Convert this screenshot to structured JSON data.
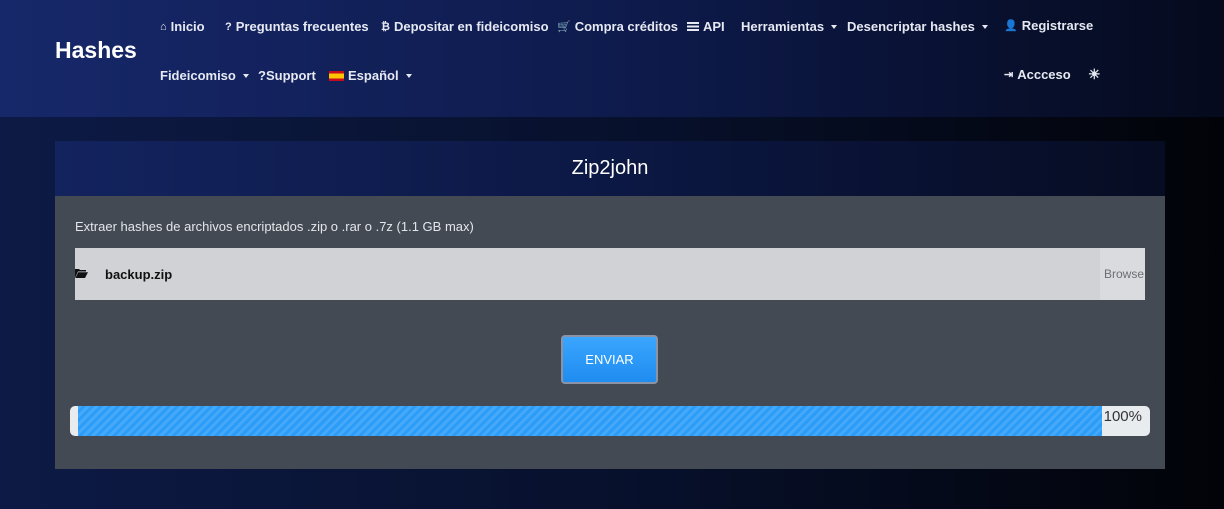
{
  "brand": "Hashes",
  "nav": {
    "inicio": "Inicio",
    "faq": "Preguntas frecuentes",
    "escrow_deposit": "Depositar en fideicomiso",
    "buy_credits": "Compra créditos",
    "api": "API",
    "tools": "Herramientas",
    "decrypt": "Desencriptar hashes",
    "register": "Registrarse",
    "escrow": "Fideicomiso",
    "support": "Support",
    "language": "Español",
    "login": "Accceso"
  },
  "card": {
    "title": "Zip2john",
    "description": "Extraer hashes de archivos encriptados .zip o .rar o .7z (1.1 GB max)",
    "file_name": "backup.zip",
    "browse_label": "Browse",
    "submit_label": "ENVIAR",
    "progress_percent": 100,
    "progress_label": "100%"
  },
  "colors": {
    "accent": "#2b9cf7",
    "card_bg": "#434a54",
    "header_bg": "#13235e"
  },
  "icons": [
    "home-icon",
    "question-icon",
    "bitcoin-icon",
    "cart-icon",
    "list-icon",
    "user-plus-icon",
    "spain-flag-icon",
    "login-icon",
    "sun-icon",
    "folder-open-icon"
  ]
}
